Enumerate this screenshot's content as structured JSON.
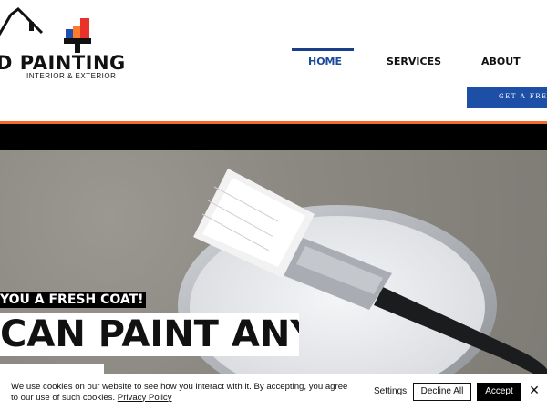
{
  "logo": {
    "name": "D PAINTING",
    "tagline": "INTERIOR & EXTERIOR"
  },
  "nav": {
    "items": [
      {
        "label": "HOME"
      },
      {
        "label": "SERVICES"
      },
      {
        "label": "ABOUT"
      }
    ],
    "active": "HOME"
  },
  "cta": {
    "label": "GET A FREE"
  },
  "hero": {
    "tagline": "YOU A FRESH COAT!",
    "headline": "CAN PAINT ANY"
  },
  "cookie": {
    "message": "We use cookies on our website to see how you interact with it. By accepting, you agree to our use of such cookies.",
    "policy_link": "Privacy Policy",
    "settings": "Settings",
    "decline": "Decline All",
    "accept": "Accept"
  },
  "colors": {
    "accent_blue": "#1d4fa6",
    "accent_orange": "#f26b2a",
    "logo_red": "#e8322a",
    "logo_blue": "#1f4fb0"
  },
  "icons": {
    "close": "close-icon"
  }
}
